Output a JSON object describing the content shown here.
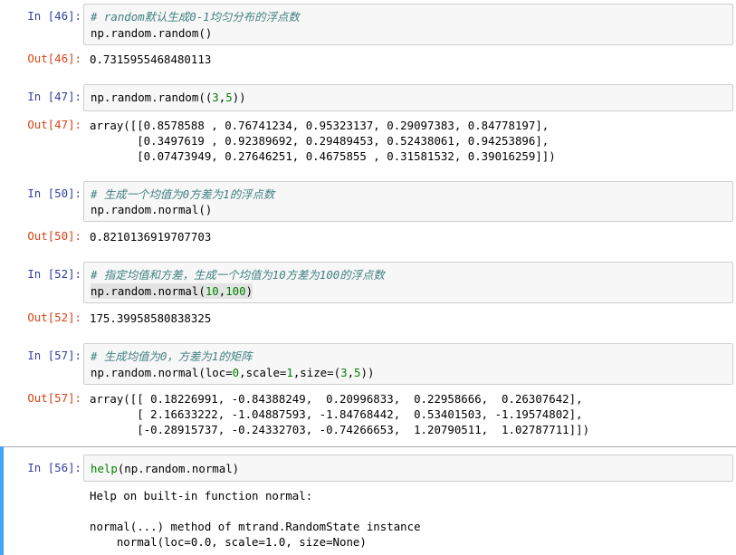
{
  "cells": [
    {
      "in_prompt": "In [46]:",
      "code_comment": "# random默认生成0-1均匀分布的浮点数",
      "code_line2": "np.random.random()",
      "out_prompt": "Out[46]:",
      "output": [
        "0.7315955468480113"
      ]
    },
    {
      "in_prompt": "In [47]:",
      "code_pre": "np.random.random((",
      "code_n1": "3",
      "code_comma": ",",
      "code_n2": "5",
      "code_post": "))",
      "out_prompt": "Out[47]:",
      "output": [
        "array([[0.8578588 , 0.76741234, 0.95323137, 0.29097383, 0.84778197],",
        "       [0.3497619 , 0.92389692, 0.29489453, 0.52438061, 0.94253896],",
        "       [0.07473949, 0.27646251, 0.4675855 , 0.31581532, 0.39016259]])"
      ]
    },
    {
      "in_prompt": "In [50]:",
      "code_comment": "# 生成一个均值为0方差为1的浮点数",
      "code_line2": "np.random.normal()",
      "out_prompt": "Out[50]:",
      "output": [
        "0.8210136919707703"
      ]
    },
    {
      "in_prompt": "In [52]:",
      "code_comment": "# 指定均值和方差，生成一个均值为10方差为100的浮点数",
      "code_pre": "np.random.normal(",
      "code_n1": "10",
      "code_comma": ",",
      "code_n2": "100",
      "code_post": ")",
      "out_prompt": "Out[52]:",
      "output": [
        "175.39958580838325"
      ]
    },
    {
      "in_prompt": "In [57]:",
      "code_comment": "# 生成均值为0，方差为1的矩阵",
      "code_l2_a": "np.random.normal(loc",
      "code_l2_eq1": "=",
      "code_l2_n0": "0",
      "code_l2_b": ",scale",
      "code_l2_eq2": "=",
      "code_l2_n1": "1",
      "code_l2_c": ",size",
      "code_l2_eq3": "=",
      "code_l2_d": "(",
      "code_l2_n3": "3",
      "code_l2_e": ",",
      "code_l2_n5": "5",
      "code_l2_f": "))",
      "out_prompt": "Out[57]:",
      "output": [
        "array([[ 0.18226991, -0.84388249,  0.20996833,  0.22958666,  0.26307642],",
        "       [ 2.16633222, -1.04887593, -1.84768442,  0.53401503, -1.19574802],",
        "       [-0.28915737, -0.24332703, -0.74266653,  1.20790511,  1.02787711]])"
      ]
    },
    {
      "in_prompt": "In [56]:",
      "code_help": "help",
      "code_rest": "(np.random.normal)",
      "output": [
        "Help on built-in function normal:",
        "",
        "normal(...) method of mtrand.RandomState instance",
        "    normal(loc=0.0, scale=1.0, size=None)"
      ]
    }
  ]
}
